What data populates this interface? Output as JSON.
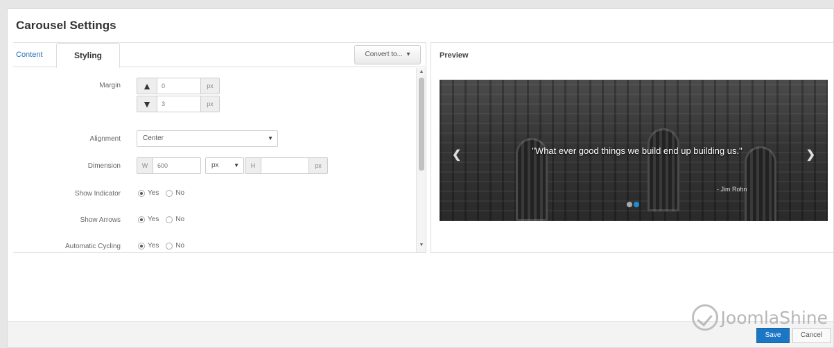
{
  "dialog": {
    "title": "Carousel Settings"
  },
  "tabs": [
    {
      "label": "Content"
    },
    {
      "label": "Styling"
    }
  ],
  "convert_button": "Convert to...",
  "form": {
    "margin": {
      "label": "Margin",
      "top_value": "0",
      "bottom_value": "3",
      "unit": "px"
    },
    "alignment": {
      "label": "Alignment",
      "value": "Center"
    },
    "dimension": {
      "label": "Dimension",
      "w_label": "W",
      "w_value": "600",
      "w_unit": "px",
      "h_label": "H",
      "h_value": "",
      "h_unit": "px"
    },
    "show_indicator": {
      "label": "Show Indicator",
      "yes": "Yes",
      "no": "No",
      "selected": "Yes"
    },
    "show_arrows": {
      "label": "Show Arrows",
      "yes": "Yes",
      "no": "No",
      "selected": "Yes"
    },
    "automatic_cycling": {
      "label": "Automatic Cycling",
      "yes": "Yes",
      "no": "No",
      "selected": "Yes"
    }
  },
  "preview": {
    "title": "Preview",
    "quote": "\"What ever good things we build end up building us.\"",
    "author": "- Jim Rohn",
    "indicator_count": 2,
    "active_indicator": 2
  },
  "footer": {
    "save": "Save",
    "cancel": "Cancel"
  },
  "watermark": "JoomlaShine",
  "colors": {
    "accent": "#1b77c6",
    "indicator_active": "#1b8fd6"
  }
}
